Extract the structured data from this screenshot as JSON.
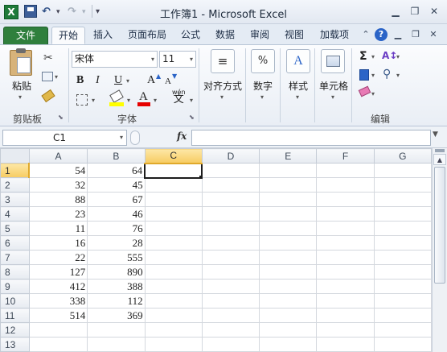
{
  "app": {
    "title": "工作簿1 - Microsoft Excel",
    "icon_letter": "X",
    "quick_access": [
      "save-icon",
      "undo-icon",
      "redo-icon",
      "customize-icon"
    ]
  },
  "tabs": [
    {
      "label": "文件",
      "selected": false
    },
    {
      "label": "开始",
      "selected": true
    },
    {
      "label": "插入",
      "selected": false
    },
    {
      "label": "页面布局",
      "selected": false
    },
    {
      "label": "公式",
      "selected": false
    },
    {
      "label": "数据",
      "selected": false
    },
    {
      "label": "审阅",
      "selected": false
    },
    {
      "label": "视图",
      "selected": false
    },
    {
      "label": "加载项",
      "selected": false
    }
  ],
  "ribbon": {
    "clipboard": {
      "paste_label": "粘贴",
      "group_label": "剪贴板"
    },
    "font": {
      "font_name": "宋体",
      "font_size": "11",
      "bold": "B",
      "italic": "I",
      "underline": "U",
      "grow": "A",
      "shrink": "A",
      "phonetic": "wén",
      "phonetic_sub": "文",
      "group_label": "字体"
    },
    "alignment": {
      "label": "对齐方式"
    },
    "number": {
      "label": "数字",
      "icon_text": "%"
    },
    "styles": {
      "label": "样式"
    },
    "cells": {
      "label": "单元格"
    },
    "editing": {
      "group_label": "编辑",
      "sum_symbol": "Σ"
    }
  },
  "formula_bar": {
    "name_box": "C1",
    "fx_label": "fx",
    "formula": ""
  },
  "sheet": {
    "columns": [
      "A",
      "B",
      "C",
      "D",
      "E",
      "F",
      "G"
    ],
    "selected_column": "C",
    "selected_row": "1",
    "active_cell": "C1",
    "rows": [
      {
        "n": "1",
        "a": "54",
        "b": "64"
      },
      {
        "n": "2",
        "a": "32",
        "b": "45"
      },
      {
        "n": "3",
        "a": "88",
        "b": "67"
      },
      {
        "n": "4",
        "a": "23",
        "b": "46"
      },
      {
        "n": "5",
        "a": "11",
        "b": "76"
      },
      {
        "n": "6",
        "a": "16",
        "b": "28"
      },
      {
        "n": "7",
        "a": "22",
        "b": "555"
      },
      {
        "n": "8",
        "a": "127",
        "b": "890"
      },
      {
        "n": "9",
        "a": "412",
        "b": "388"
      },
      {
        "n": "10",
        "a": "338",
        "b": "112"
      },
      {
        "n": "11",
        "a": "514",
        "b": "369"
      },
      {
        "n": "12",
        "a": "",
        "b": ""
      },
      {
        "n": "13",
        "a": "",
        "b": ""
      }
    ]
  }
}
